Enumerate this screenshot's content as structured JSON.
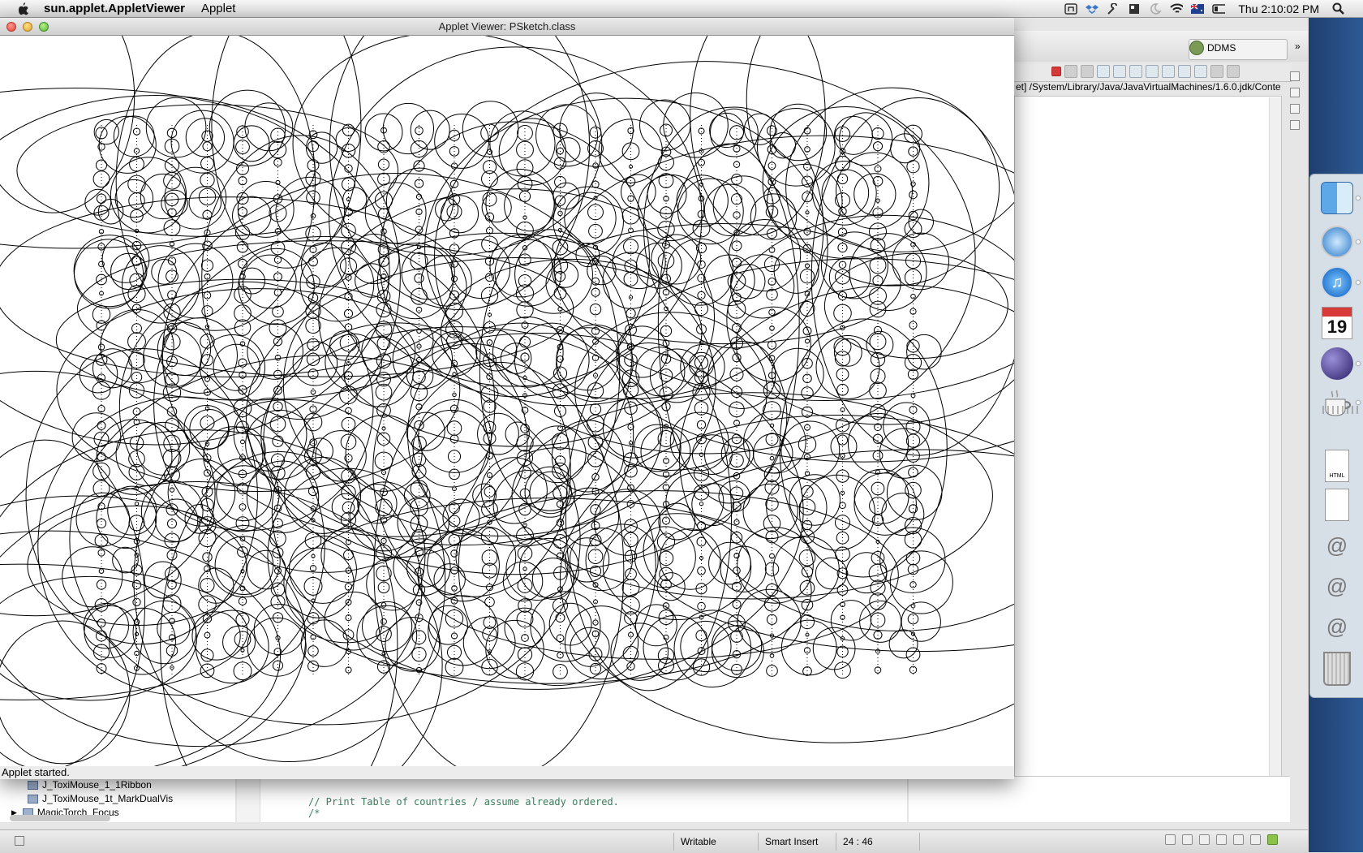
{
  "menubar": {
    "app_name": "sun.applet.AppletViewer",
    "menus": [
      "Applet"
    ],
    "clock": "Thu 2:10:02 PM",
    "extras_icons": [
      "network-icon",
      "dropbox-icon",
      "wrench-icon",
      "display-icon",
      "moon-icon",
      "wifi-icon",
      "flag-australia-icon",
      "battery-icon",
      "spotlight-icon"
    ]
  },
  "applet_window": {
    "title": "Applet Viewer: PSketch.class",
    "status": "Applet started."
  },
  "eclipse": {
    "perspective": "DDMS",
    "console_path": "et] /System/Library/Java/JavaVirtualMachines/1.6.0.jdk/Conte",
    "package_items": [
      {
        "label": "J_ToxiMouse_1_1Ribbon",
        "expandable": false
      },
      {
        "label": "J_ToxiMouse_1t_MarkDualVis",
        "expandable": false
      },
      {
        "label": "MagicTorch_Focus",
        "expandable": true
      }
    ],
    "code_lines": [
      "// Print Table of countries / assume already ordered.",
      "/*"
    ],
    "status": {
      "writable": "Writable",
      "insert_mode": "Smart Insert",
      "position": "24 : 46"
    }
  },
  "dock": {
    "items": [
      {
        "name": "finder-icon"
      },
      {
        "name": "safari-icon"
      },
      {
        "name": "itunes-icon"
      },
      {
        "name": "ical-icon",
        "label": "19"
      },
      {
        "name": "eclipse-icon"
      },
      {
        "name": "java-icon"
      },
      {
        "name": "html-document-icon",
        "label": "HTML"
      },
      {
        "name": "document-icon"
      },
      {
        "name": "mail-stack-icon"
      },
      {
        "name": "mail-stack-icon"
      },
      {
        "name": "mail-stack-icon"
      },
      {
        "name": "trash-icon"
      }
    ]
  }
}
